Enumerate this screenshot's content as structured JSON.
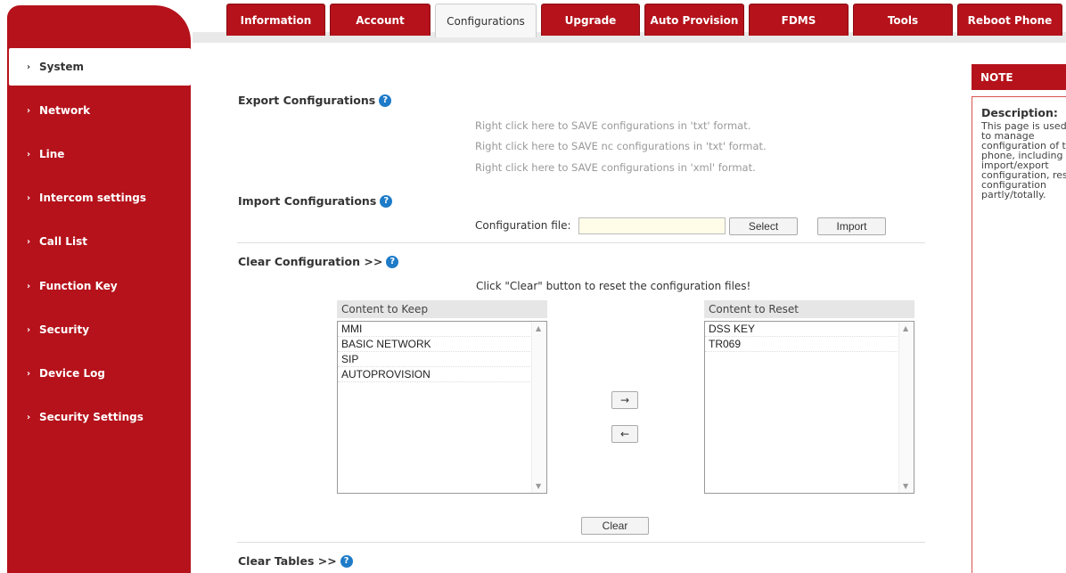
{
  "tabs": [
    {
      "label": "Information",
      "width": 114
    },
    {
      "label": "Account",
      "width": 114
    },
    {
      "label": "Configurations",
      "width": 114
    },
    {
      "label": "Upgrade",
      "width": 114
    },
    {
      "label": "Auto Provision",
      "width": 114
    },
    {
      "label": "FDMS",
      "width": 114
    },
    {
      "label": "Tools",
      "width": 114
    },
    {
      "label": "Reboot Phone",
      "width": 114
    }
  ],
  "sidebar": {
    "items": [
      {
        "label": "System"
      },
      {
        "label": "Network"
      },
      {
        "label": "Line"
      },
      {
        "label": "Intercom settings"
      },
      {
        "label": "Call List"
      },
      {
        "label": "Function Key"
      },
      {
        "label": "Security"
      },
      {
        "label": "Device Log"
      },
      {
        "label": "Security Settings"
      }
    ]
  },
  "export": {
    "title": "Export Configurations",
    "links": [
      "Right click here to SAVE configurations in 'txt' format.",
      "Right click here to SAVE nc configurations in 'txt' format.",
      "Right click here to SAVE configurations in 'xml' format."
    ]
  },
  "import": {
    "title": "Import Configurations",
    "file_label": "Configuration file:",
    "file_value": "",
    "select_label": "Select",
    "import_label": "Import"
  },
  "clear_config": {
    "title": "Clear Configuration >>",
    "instruction": "Click \"Clear\" button to reset the configuration files!",
    "keep_header": "Content to Keep",
    "keep_items": [
      "MMI",
      "BASIC NETWORK",
      "SIP",
      "AUTOPROVISION"
    ],
    "reset_header": "Content to Reset",
    "reset_items": [
      "DSS KEY",
      "TR069"
    ],
    "move_right": "→",
    "move_left": "←",
    "clear_label": "Clear"
  },
  "clear_tables": {
    "title": "Clear Tables >>"
  },
  "note": {
    "header": "NOTE",
    "title": "Description:",
    "text": "This page is used to manage configuration of the phone, including import/export configuration, reset configuration partly/totally."
  },
  "colors": {
    "brand_red": "#b5121b",
    "help_blue": "#1e7bc8"
  }
}
